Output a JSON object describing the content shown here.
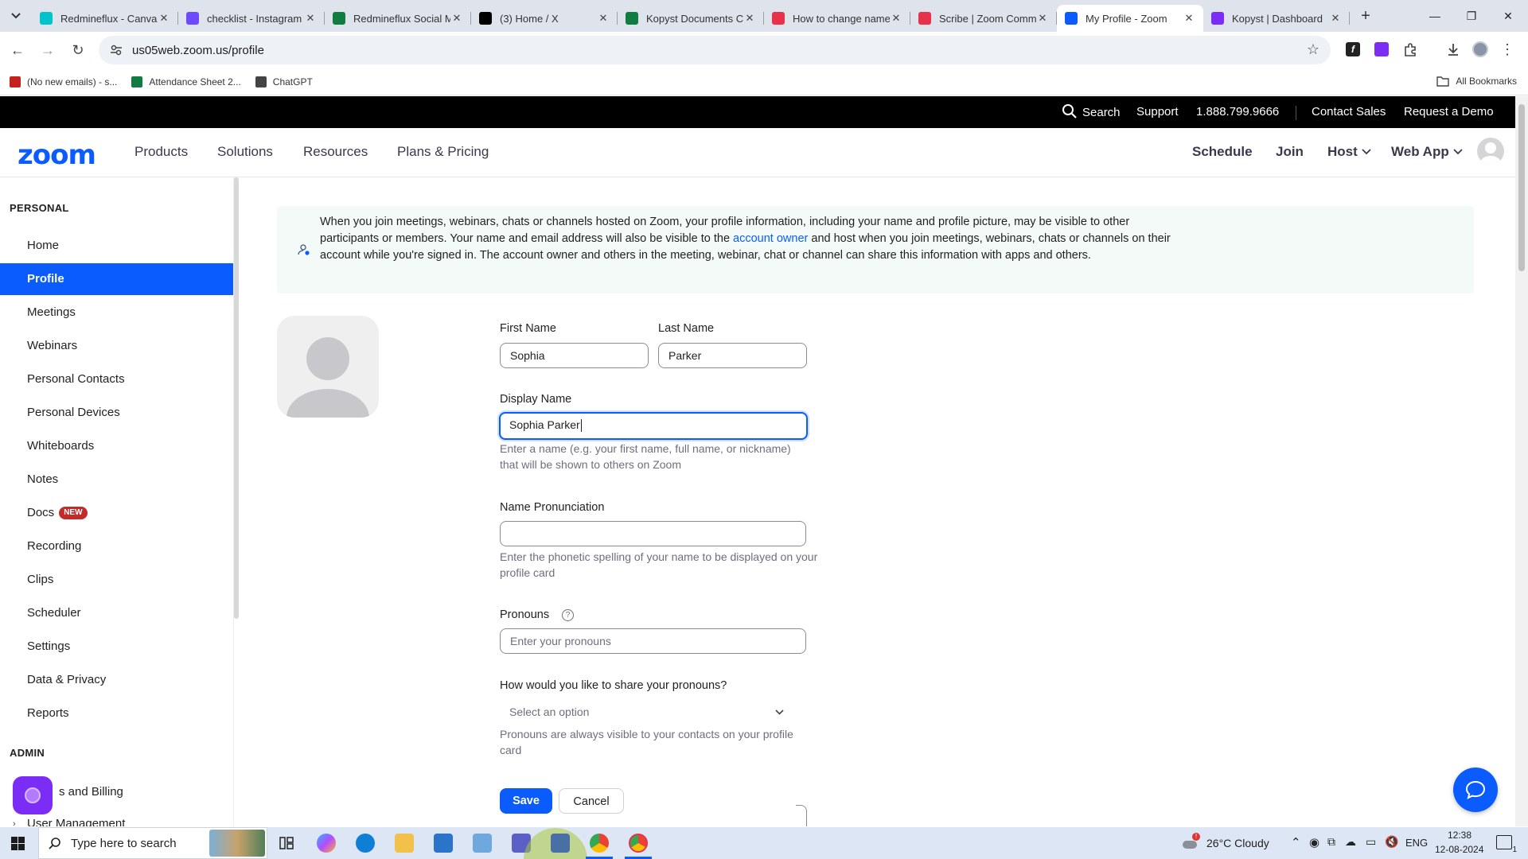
{
  "browser": {
    "tabs": [
      {
        "title": "Redmineflux - Canva",
        "icon": "canva-icon",
        "color": "#00c4cc"
      },
      {
        "title": "checklist - Instagram",
        "icon": "heart-icon",
        "color": "#6d4aff"
      },
      {
        "title": "Redmineflux Social M",
        "icon": "excel-icon",
        "color": "#107c41"
      },
      {
        "title": "(3) Home / X",
        "icon": "x-icon",
        "color": "#000000"
      },
      {
        "title": "Kopyst Documents Cr",
        "icon": "excel-icon",
        "color": "#107c41"
      },
      {
        "title": "How to change name",
        "icon": "scribe-icon",
        "color": "#e8324b"
      },
      {
        "title": "Scribe | Zoom Comm",
        "icon": "scribe-icon",
        "color": "#e8324b"
      },
      {
        "title": "My Profile - Zoom",
        "icon": "zoom-icon",
        "color": "#0b5cff"
      },
      {
        "title": "Kopyst | Dashboard",
        "icon": "kopyst-icon",
        "color": "#7b2cf5"
      }
    ],
    "url": "us05web.zoom.us/profile",
    "bookmarks": [
      {
        "label": "(No new emails) - s...",
        "icon": "gmail-icon",
        "color": "#c5221f"
      },
      {
        "label": "Attendance Sheet 2...",
        "icon": "excel-icon",
        "color": "#107c41"
      },
      {
        "label": "ChatGPT",
        "icon": "chatgpt-icon",
        "color": "#444444"
      }
    ],
    "all_bookmarks": "All Bookmarks"
  },
  "topbar": {
    "search": "Search",
    "support": "Support",
    "phone": "1.888.799.9666",
    "contact_sales": "Contact Sales",
    "request_demo": "Request a Demo"
  },
  "nav": {
    "logo": "zoom",
    "products": "Products",
    "solutions": "Solutions",
    "resources": "Resources",
    "plans": "Plans & Pricing",
    "schedule": "Schedule",
    "join": "Join",
    "host": "Host",
    "web_app": "Web App"
  },
  "sidebar": {
    "personal_header": "PERSONAL",
    "items": [
      {
        "label": "Home"
      },
      {
        "label": "Profile",
        "active": true
      },
      {
        "label": "Meetings"
      },
      {
        "label": "Webinars"
      },
      {
        "label": "Personal Contacts"
      },
      {
        "label": "Personal Devices"
      },
      {
        "label": "Whiteboards"
      },
      {
        "label": "Notes"
      },
      {
        "label": "Docs",
        "badge": "NEW"
      },
      {
        "label": "Recording"
      },
      {
        "label": "Clips"
      },
      {
        "label": "Scheduler"
      },
      {
        "label": "Settings"
      },
      {
        "label": "Data & Privacy"
      },
      {
        "label": "Reports"
      }
    ],
    "admin_header": "ADMIN",
    "admin_items": [
      {
        "label": "s and Billing"
      },
      {
        "label": "User Management"
      }
    ]
  },
  "notice": {
    "text_before": "When you join meetings, webinars, chats or channels hosted on Zoom, your profile information, including your name and profile picture, may be visible to other participants or members. Your name and email address will also be visible to the ",
    "link": "account owner",
    "text_after": " and host when you join meetings, webinars, chats or channels on their account while you're signed in. The account owner and others in the meeting, webinar, chat or channel can share this information with apps and others."
  },
  "form": {
    "first_name_label": "First Name",
    "first_name_value": "Sophia",
    "last_name_label": "Last Name",
    "last_name_value": "Parker",
    "display_name_label": "Display Name",
    "display_name_value": "Sophia Parker",
    "display_name_hint": "Enter a name (e.g. your first name, full name, or nickname) that will be shown to others on Zoom",
    "pronunciation_label": "Name Pronunciation",
    "pronunciation_value": "",
    "pronunciation_hint": "Enter the phonetic spelling of your name to be displayed on your profile card",
    "pronouns_label": "Pronouns",
    "pronouns_placeholder": "Enter your pronouns",
    "share_label": "How would you like to share your pronouns?",
    "share_selected": "Select an option",
    "share_hint": "Pronouns are always visible to your contacts on your profile card",
    "save": "Save",
    "cancel": "Cancel"
  },
  "taskbar": {
    "search_placeholder": "Type here to search",
    "weather": "26°C  Cloudy",
    "language": "ENG",
    "time": "12:38",
    "date": "12-08-2024",
    "notification_count": "1"
  }
}
